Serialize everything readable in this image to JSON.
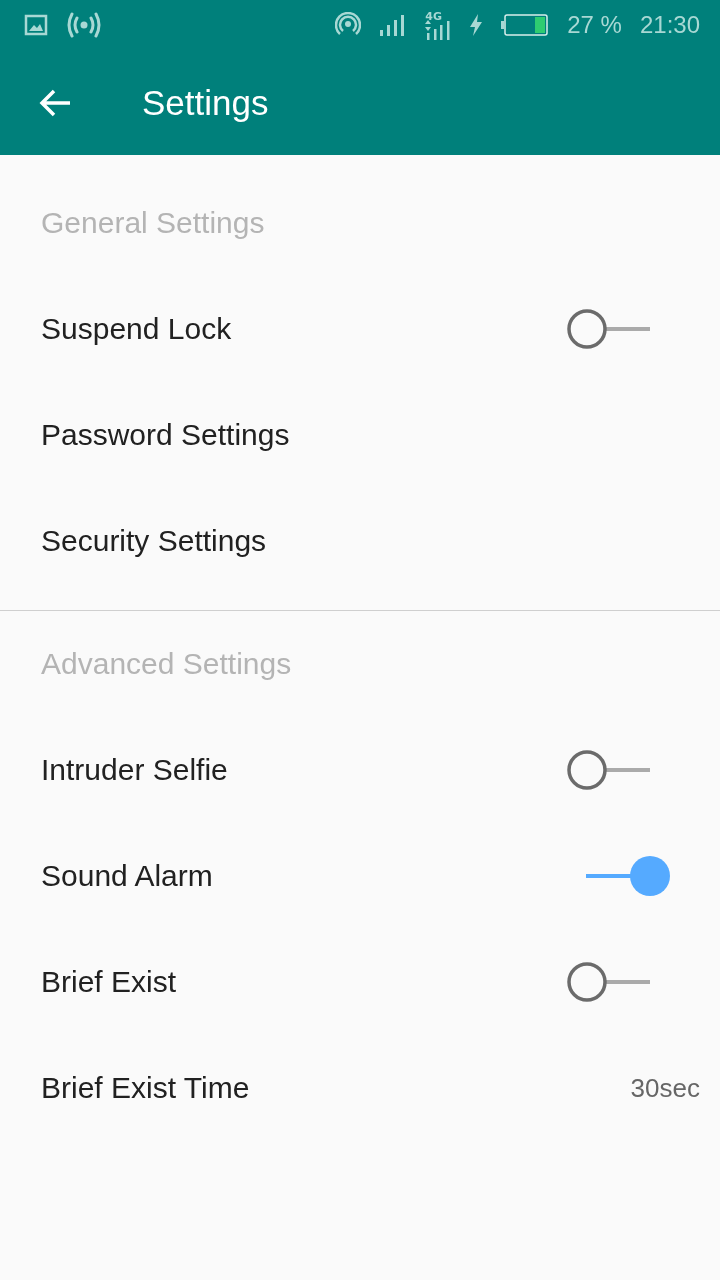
{
  "status_bar": {
    "network_label": "4G",
    "battery": "27 %",
    "time": "21:30"
  },
  "app_bar": {
    "title": "Settings"
  },
  "sections": [
    {
      "title": "General Settings",
      "items": [
        {
          "kind": "toggle",
          "label": "Suspend Lock",
          "on": false
        },
        {
          "kind": "link",
          "label": "Password Settings"
        },
        {
          "kind": "link",
          "label": "Security Settings"
        }
      ]
    },
    {
      "title": "Advanced Settings",
      "items": [
        {
          "kind": "toggle",
          "label": "Intruder Selfie",
          "on": false
        },
        {
          "kind": "toggle",
          "label": "Sound Alarm",
          "on": true
        },
        {
          "kind": "toggle",
          "label": "Brief Exist",
          "on": false
        },
        {
          "kind": "value",
          "label": "Brief Exist Time",
          "value": "30sec"
        }
      ]
    }
  ]
}
